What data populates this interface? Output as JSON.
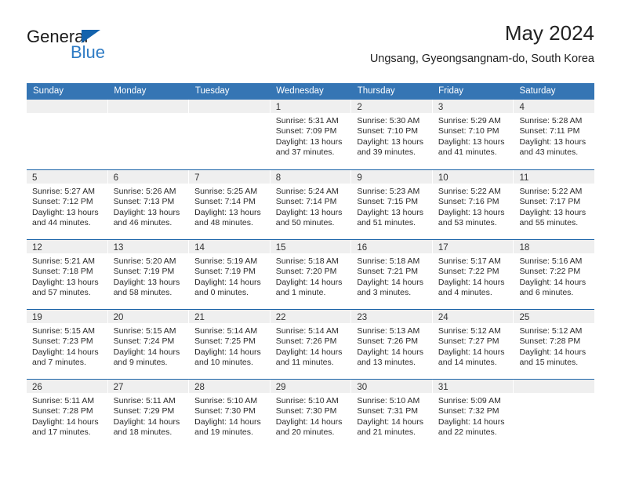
{
  "brand": {
    "name_dark": "General",
    "name_blue": "Blue",
    "accent_color": "#2e7bc4",
    "triangle_color": "#1463ad"
  },
  "header": {
    "title": "May 2024",
    "subtitle": "Ungsang, Gyeongsangnam-do, South Korea"
  },
  "calendar": {
    "header_bg": "#3575b4",
    "row_divider": "#1a63a8",
    "daynum_band_bg": "#efefef",
    "weekdays": [
      "Sunday",
      "Monday",
      "Tuesday",
      "Wednesday",
      "Thursday",
      "Friday",
      "Saturday"
    ],
    "weeks": [
      [
        {
          "day": "",
          "sunrise": "",
          "sunset": "",
          "daylight1": "",
          "daylight2": ""
        },
        {
          "day": "",
          "sunrise": "",
          "sunset": "",
          "daylight1": "",
          "daylight2": ""
        },
        {
          "day": "",
          "sunrise": "",
          "sunset": "",
          "daylight1": "",
          "daylight2": ""
        },
        {
          "day": "1",
          "sunrise": "Sunrise: 5:31 AM",
          "sunset": "Sunset: 7:09 PM",
          "daylight1": "Daylight: 13 hours",
          "daylight2": "and 37 minutes."
        },
        {
          "day": "2",
          "sunrise": "Sunrise: 5:30 AM",
          "sunset": "Sunset: 7:10 PM",
          "daylight1": "Daylight: 13 hours",
          "daylight2": "and 39 minutes."
        },
        {
          "day": "3",
          "sunrise": "Sunrise: 5:29 AM",
          "sunset": "Sunset: 7:10 PM",
          "daylight1": "Daylight: 13 hours",
          "daylight2": "and 41 minutes."
        },
        {
          "day": "4",
          "sunrise": "Sunrise: 5:28 AM",
          "sunset": "Sunset: 7:11 PM",
          "daylight1": "Daylight: 13 hours",
          "daylight2": "and 43 minutes."
        }
      ],
      [
        {
          "day": "5",
          "sunrise": "Sunrise: 5:27 AM",
          "sunset": "Sunset: 7:12 PM",
          "daylight1": "Daylight: 13 hours",
          "daylight2": "and 44 minutes."
        },
        {
          "day": "6",
          "sunrise": "Sunrise: 5:26 AM",
          "sunset": "Sunset: 7:13 PM",
          "daylight1": "Daylight: 13 hours",
          "daylight2": "and 46 minutes."
        },
        {
          "day": "7",
          "sunrise": "Sunrise: 5:25 AM",
          "sunset": "Sunset: 7:14 PM",
          "daylight1": "Daylight: 13 hours",
          "daylight2": "and 48 minutes."
        },
        {
          "day": "8",
          "sunrise": "Sunrise: 5:24 AM",
          "sunset": "Sunset: 7:14 PM",
          "daylight1": "Daylight: 13 hours",
          "daylight2": "and 50 minutes."
        },
        {
          "day": "9",
          "sunrise": "Sunrise: 5:23 AM",
          "sunset": "Sunset: 7:15 PM",
          "daylight1": "Daylight: 13 hours",
          "daylight2": "and 51 minutes."
        },
        {
          "day": "10",
          "sunrise": "Sunrise: 5:22 AM",
          "sunset": "Sunset: 7:16 PM",
          "daylight1": "Daylight: 13 hours",
          "daylight2": "and 53 minutes."
        },
        {
          "day": "11",
          "sunrise": "Sunrise: 5:22 AM",
          "sunset": "Sunset: 7:17 PM",
          "daylight1": "Daylight: 13 hours",
          "daylight2": "and 55 minutes."
        }
      ],
      [
        {
          "day": "12",
          "sunrise": "Sunrise: 5:21 AM",
          "sunset": "Sunset: 7:18 PM",
          "daylight1": "Daylight: 13 hours",
          "daylight2": "and 57 minutes."
        },
        {
          "day": "13",
          "sunrise": "Sunrise: 5:20 AM",
          "sunset": "Sunset: 7:19 PM",
          "daylight1": "Daylight: 13 hours",
          "daylight2": "and 58 minutes."
        },
        {
          "day": "14",
          "sunrise": "Sunrise: 5:19 AM",
          "sunset": "Sunset: 7:19 PM",
          "daylight1": "Daylight: 14 hours",
          "daylight2": "and 0 minutes."
        },
        {
          "day": "15",
          "sunrise": "Sunrise: 5:18 AM",
          "sunset": "Sunset: 7:20 PM",
          "daylight1": "Daylight: 14 hours",
          "daylight2": "and 1 minute."
        },
        {
          "day": "16",
          "sunrise": "Sunrise: 5:18 AM",
          "sunset": "Sunset: 7:21 PM",
          "daylight1": "Daylight: 14 hours",
          "daylight2": "and 3 minutes."
        },
        {
          "day": "17",
          "sunrise": "Sunrise: 5:17 AM",
          "sunset": "Sunset: 7:22 PM",
          "daylight1": "Daylight: 14 hours",
          "daylight2": "and 4 minutes."
        },
        {
          "day": "18",
          "sunrise": "Sunrise: 5:16 AM",
          "sunset": "Sunset: 7:22 PM",
          "daylight1": "Daylight: 14 hours",
          "daylight2": "and 6 minutes."
        }
      ],
      [
        {
          "day": "19",
          "sunrise": "Sunrise: 5:15 AM",
          "sunset": "Sunset: 7:23 PM",
          "daylight1": "Daylight: 14 hours",
          "daylight2": "and 7 minutes."
        },
        {
          "day": "20",
          "sunrise": "Sunrise: 5:15 AM",
          "sunset": "Sunset: 7:24 PM",
          "daylight1": "Daylight: 14 hours",
          "daylight2": "and 9 minutes."
        },
        {
          "day": "21",
          "sunrise": "Sunrise: 5:14 AM",
          "sunset": "Sunset: 7:25 PM",
          "daylight1": "Daylight: 14 hours",
          "daylight2": "and 10 minutes."
        },
        {
          "day": "22",
          "sunrise": "Sunrise: 5:14 AM",
          "sunset": "Sunset: 7:26 PM",
          "daylight1": "Daylight: 14 hours",
          "daylight2": "and 11 minutes."
        },
        {
          "day": "23",
          "sunrise": "Sunrise: 5:13 AM",
          "sunset": "Sunset: 7:26 PM",
          "daylight1": "Daylight: 14 hours",
          "daylight2": "and 13 minutes."
        },
        {
          "day": "24",
          "sunrise": "Sunrise: 5:12 AM",
          "sunset": "Sunset: 7:27 PM",
          "daylight1": "Daylight: 14 hours",
          "daylight2": "and 14 minutes."
        },
        {
          "day": "25",
          "sunrise": "Sunrise: 5:12 AM",
          "sunset": "Sunset: 7:28 PM",
          "daylight1": "Daylight: 14 hours",
          "daylight2": "and 15 minutes."
        }
      ],
      [
        {
          "day": "26",
          "sunrise": "Sunrise: 5:11 AM",
          "sunset": "Sunset: 7:28 PM",
          "daylight1": "Daylight: 14 hours",
          "daylight2": "and 17 minutes."
        },
        {
          "day": "27",
          "sunrise": "Sunrise: 5:11 AM",
          "sunset": "Sunset: 7:29 PM",
          "daylight1": "Daylight: 14 hours",
          "daylight2": "and 18 minutes."
        },
        {
          "day": "28",
          "sunrise": "Sunrise: 5:10 AM",
          "sunset": "Sunset: 7:30 PM",
          "daylight1": "Daylight: 14 hours",
          "daylight2": "and 19 minutes."
        },
        {
          "day": "29",
          "sunrise": "Sunrise: 5:10 AM",
          "sunset": "Sunset: 7:30 PM",
          "daylight1": "Daylight: 14 hours",
          "daylight2": "and 20 minutes."
        },
        {
          "day": "30",
          "sunrise": "Sunrise: 5:10 AM",
          "sunset": "Sunset: 7:31 PM",
          "daylight1": "Daylight: 14 hours",
          "daylight2": "and 21 minutes."
        },
        {
          "day": "31",
          "sunrise": "Sunrise: 5:09 AM",
          "sunset": "Sunset: 7:32 PM",
          "daylight1": "Daylight: 14 hours",
          "daylight2": "and 22 minutes."
        },
        {
          "day": "",
          "sunrise": "",
          "sunset": "",
          "daylight1": "",
          "daylight2": ""
        }
      ]
    ]
  }
}
